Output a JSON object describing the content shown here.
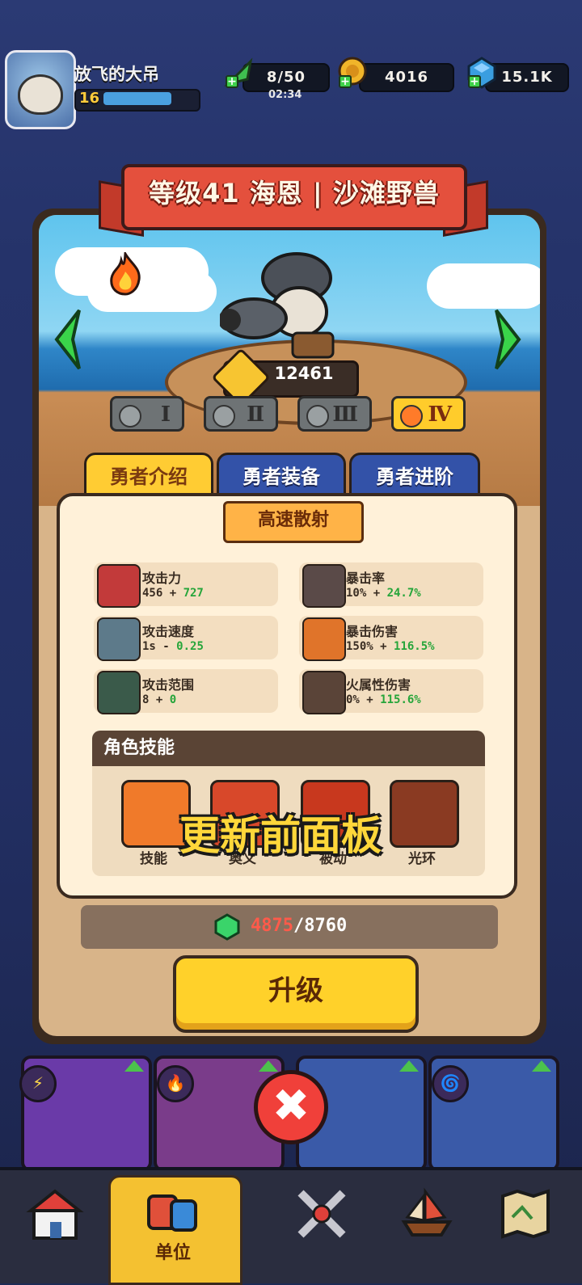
{
  "player": {
    "name": "放飞的大吊",
    "level": "16",
    "level_progress": 0.75
  },
  "resources": {
    "stamina": "8/50",
    "stamina_timer": "02:34",
    "gold": "4016",
    "gems": "15.1K"
  },
  "hero": {
    "title": "等级41 海恩 | 沙滩野兽",
    "power": "12461",
    "ranks": [
      "Ⅰ",
      "Ⅱ",
      "Ⅲ",
      "Ⅳ"
    ],
    "active_rank": "Ⅳ",
    "element": "fire"
  },
  "tabs": [
    "勇者介绍",
    "勇者装备",
    "勇者进阶"
  ],
  "active_tab": "勇者介绍",
  "weapon_name": "高速散射",
  "stats": [
    {
      "name": "攻击力",
      "base": "456 + ",
      "bonus": "727"
    },
    {
      "name": "暴击率",
      "base": "10% + ",
      "bonus": "24.7%"
    },
    {
      "name": "攻击速度",
      "base": "1s - ",
      "bonus": "0.25"
    },
    {
      "name": "暴击伤害",
      "base": "150% + ",
      "bonus": "116.5%"
    },
    {
      "name": "攻击范围",
      "base": "8 + ",
      "bonus": "0"
    },
    {
      "name": "火属性伤害",
      "base": "0% + ",
      "bonus": "115.6%"
    }
  ],
  "skills": {
    "heading": "角色技能",
    "items": [
      "技能",
      "奥义",
      "被动",
      "光环"
    ]
  },
  "overlay_caption": "更新前面板",
  "upgrade_cost": {
    "have": "4875",
    "need": "/8760"
  },
  "upgrade_label": "升级",
  "close_symbol": "✖",
  "nav": {
    "active_label": "单位"
  }
}
